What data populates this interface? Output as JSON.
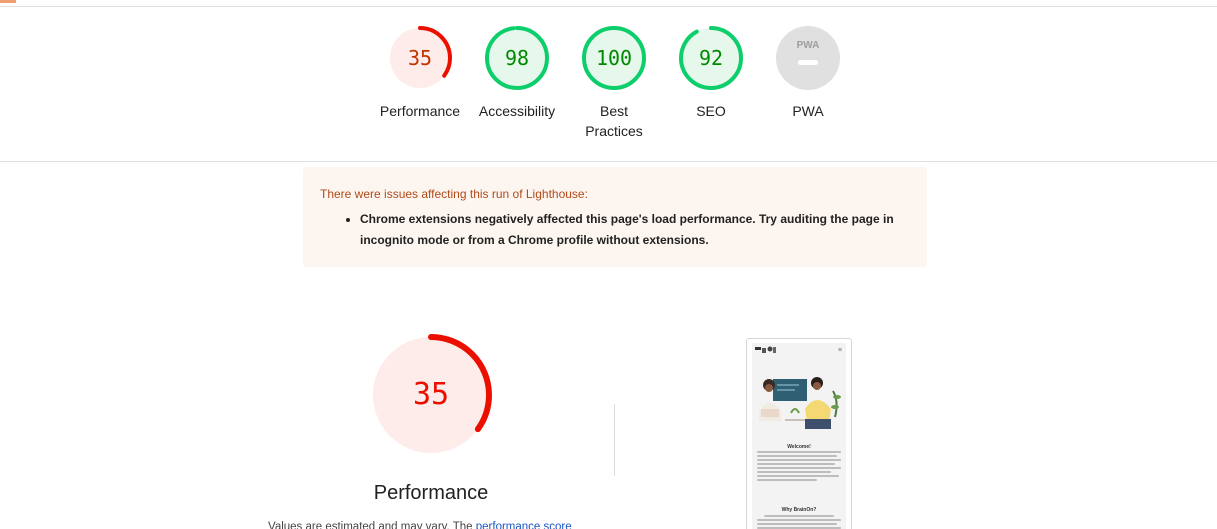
{
  "gauges": [
    {
      "score": "35",
      "label": "Performance",
      "value_fraction": 0.35,
      "color": "#eb0f00",
      "track": "#fce8e6",
      "fill": "#fdecea"
    },
    {
      "score": "98",
      "label": "Accessibility",
      "value_fraction": 0.98,
      "color": "#0cce6b",
      "track": "#e6f9ed",
      "fill": "#e6f7ec"
    },
    {
      "score": "100",
      "label": "Best Practices",
      "value_fraction": 1.0,
      "color": "#0cce6b",
      "track": "#e6f9ed",
      "fill": "#e6f7ec"
    },
    {
      "score": "92",
      "label": "SEO",
      "value_fraction": 0.92,
      "color": "#0cce6b",
      "track": "#e6f9ed",
      "fill": "#e6f7ec"
    },
    {
      "score": "",
      "label": "PWA",
      "badge_text": "PWA",
      "color": "#b0b0b0",
      "fill": "#e0e0e0"
    }
  ],
  "warning": {
    "title": "There were issues affecting this run of Lighthouse:",
    "items": [
      "Chrome extensions negatively affected this page's load performance. Try auditing the page in incognito mode or from a Chrome profile without extensions."
    ]
  },
  "performance_section": {
    "score": "35",
    "value_fraction": 0.35,
    "title": "Performance",
    "footnote_prefix": "Values are estimated and may vary. The ",
    "footnote_link": "performance score"
  },
  "screenshot_preview": {
    "welcome": "Welcome!",
    "why": "Why BrainOn?"
  },
  "colors": {
    "fail": "#eb0f00",
    "pass": "#0cce6b",
    "text_score_pass": "#008800",
    "text_score_fail": "#c33300",
    "warning_bg": "#fdf6f0",
    "warning_title": "#b04a18"
  }
}
